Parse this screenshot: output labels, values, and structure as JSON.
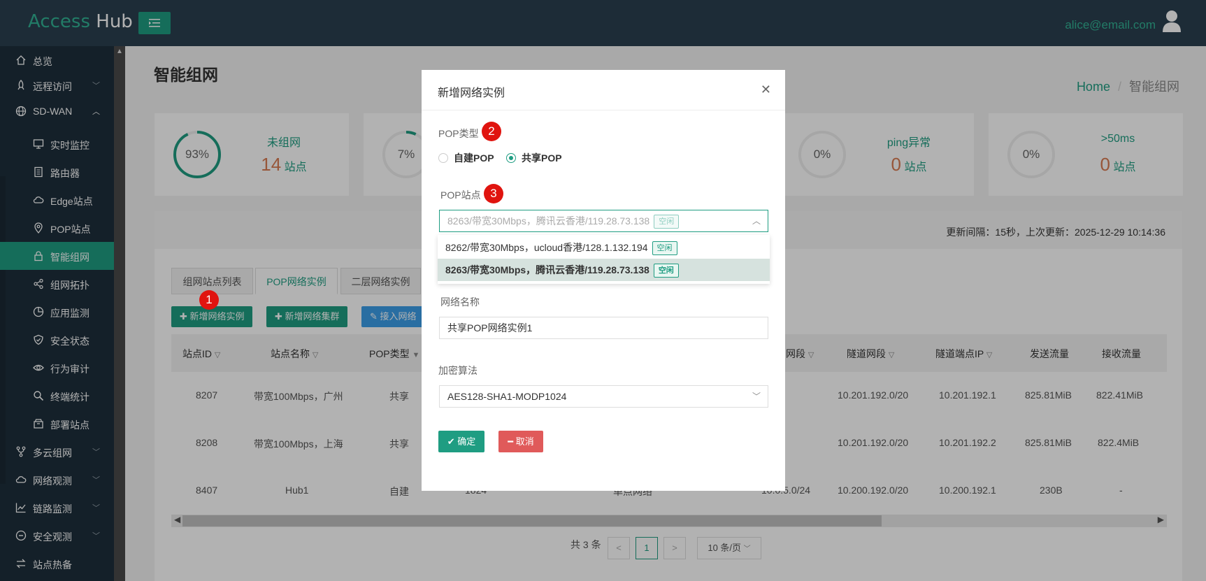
{
  "app": {
    "logo_access": "Access",
    "logo_hub": "Hub",
    "user_email": "alice@email.com"
  },
  "sidebar": {
    "items": [
      {
        "label": "总览",
        "icon": "home-icon"
      },
      {
        "label": "远程访问",
        "icon": "rocket-icon"
      },
      {
        "label": "SD-WAN",
        "icon": "globe-icon"
      },
      {
        "label": "多云组网",
        "icon": "fork-icon"
      },
      {
        "label": "网络观测",
        "icon": "cloud-icon"
      },
      {
        "label": "链路监测",
        "icon": "line-chart-icon"
      },
      {
        "label": "安全观测",
        "icon": "minus-circle-icon"
      },
      {
        "label": "站点热备",
        "icon": "swap-icon"
      }
    ],
    "sub_items": [
      {
        "label": "实时监控",
        "icon": "monitor-icon"
      },
      {
        "label": "路由器",
        "icon": "router-icon"
      },
      {
        "label": "Edge站点",
        "icon": "cloud-icon"
      },
      {
        "label": "POP站点",
        "icon": "location-icon"
      },
      {
        "label": "智能组网",
        "icon": "lock-icon"
      },
      {
        "label": "组网拓扑",
        "icon": "share-icon"
      },
      {
        "label": "应用监测",
        "icon": "pie-chart-icon"
      },
      {
        "label": "安全状态",
        "icon": "shield-icon"
      },
      {
        "label": "行为审计",
        "icon": "eye-icon"
      },
      {
        "label": "终端统计",
        "icon": "search-icon"
      },
      {
        "label": "部署站点",
        "icon": "box-icon"
      }
    ]
  },
  "page": {
    "title": "智能组网",
    "breadcrumb_home": "Home",
    "breadcrumb_sep": "/",
    "breadcrumb_current": "智能组网"
  },
  "cards": [
    {
      "percent": 0.93,
      "percent_label": "93%",
      "label": "未组网",
      "count": "14",
      "unit": "站点"
    },
    {
      "percent": 0.07,
      "percent_label": "7%",
      "label": "",
      "count": "",
      "unit": ""
    },
    {
      "percent": 0,
      "percent_label": "0%",
      "label": "ping异常",
      "count": "0",
      "unit": "站点"
    },
    {
      "percent": 0,
      "percent_label": "0%",
      "label": ">50ms",
      "count": "0",
      "unit": "站点"
    }
  ],
  "update_text": "更新间隔：15秒，上次更新：2025-12-29 10:14:36",
  "tabs": [
    "组网站点列表",
    "POP网络实例",
    "二层网络实例"
  ],
  "buttons": {
    "add_instance": "新增网络实例",
    "add_cluster": "新增网络集群",
    "connect": "接入网络"
  },
  "table": {
    "headers": [
      "站点ID",
      "站点名称",
      "POP类型",
      "网段",
      "隧道网段",
      "隧道端点IP",
      "发送流量",
      "接收流量"
    ],
    "rows": [
      {
        "id": "8207",
        "name": "带宽100Mbps，广州",
        "pop_type": "共享",
        "col4": "",
        "col5": "",
        "col6": "",
        "tunnel_net": "10.201.192.0/20",
        "tunnel_ip": "10.201.192.1",
        "tx": "825.81MiB",
        "rx": "822.41MiB"
      },
      {
        "id": "8208",
        "name": "带宽100Mbps，上海",
        "pop_type": "共享",
        "col4": "",
        "col5": "",
        "col6": "",
        "tunnel_net": "10.201.192.0/20",
        "tunnel_ip": "10.201.192.2",
        "tx": "825.81MiB",
        "rx": "822.4MiB"
      },
      {
        "id": "8407",
        "name": "Hub1",
        "pop_type": "自建",
        "col4": "1824",
        "col5": "单点网络",
        "col6": "10.0.5.0/24",
        "tunnel_net": "10.200.192.0/20",
        "tunnel_ip": "10.200.192.1",
        "tx": "230B",
        "rx": "-"
      }
    ]
  },
  "pager": {
    "total": "共 3 条",
    "prev": "<",
    "page": "1",
    "next": ">",
    "page_size": "10 条/页"
  },
  "modal": {
    "title": "新增网络实例",
    "pop_type_label": "POP类型",
    "pop_type_options": [
      "自建POP",
      "共享POP"
    ],
    "pop_type_selected": "共享POP",
    "pop_site_label": "POP站点",
    "pop_site_value": "8263/带宽30Mbps，腾讯云香港/119.28.73.138",
    "pop_site_tag": "空闲",
    "options": [
      {
        "text": "8262/带宽30Mbps，ucloud香港/128.1.132.194",
        "tag": "空闲"
      },
      {
        "text": "8263/带宽30Mbps，腾讯云香港/119.28.73.138",
        "tag": "空闲"
      }
    ],
    "net_name_label": "网络名称",
    "net_name_value": "共享POP网络实例1",
    "encrypt_label": "加密算法",
    "encrypt_value": "AES128-SHA1-MODP1024",
    "ok": "确定",
    "cancel": "取消"
  },
  "annotations": [
    "1",
    "2",
    "3"
  ],
  "colors": {
    "primary": "#1f9d82",
    "header": "#2a3f4f",
    "sidebar": "#1e2f3b",
    "danger": "#e05a5a",
    "badge": "#e0140f",
    "count": "#d97b52"
  }
}
